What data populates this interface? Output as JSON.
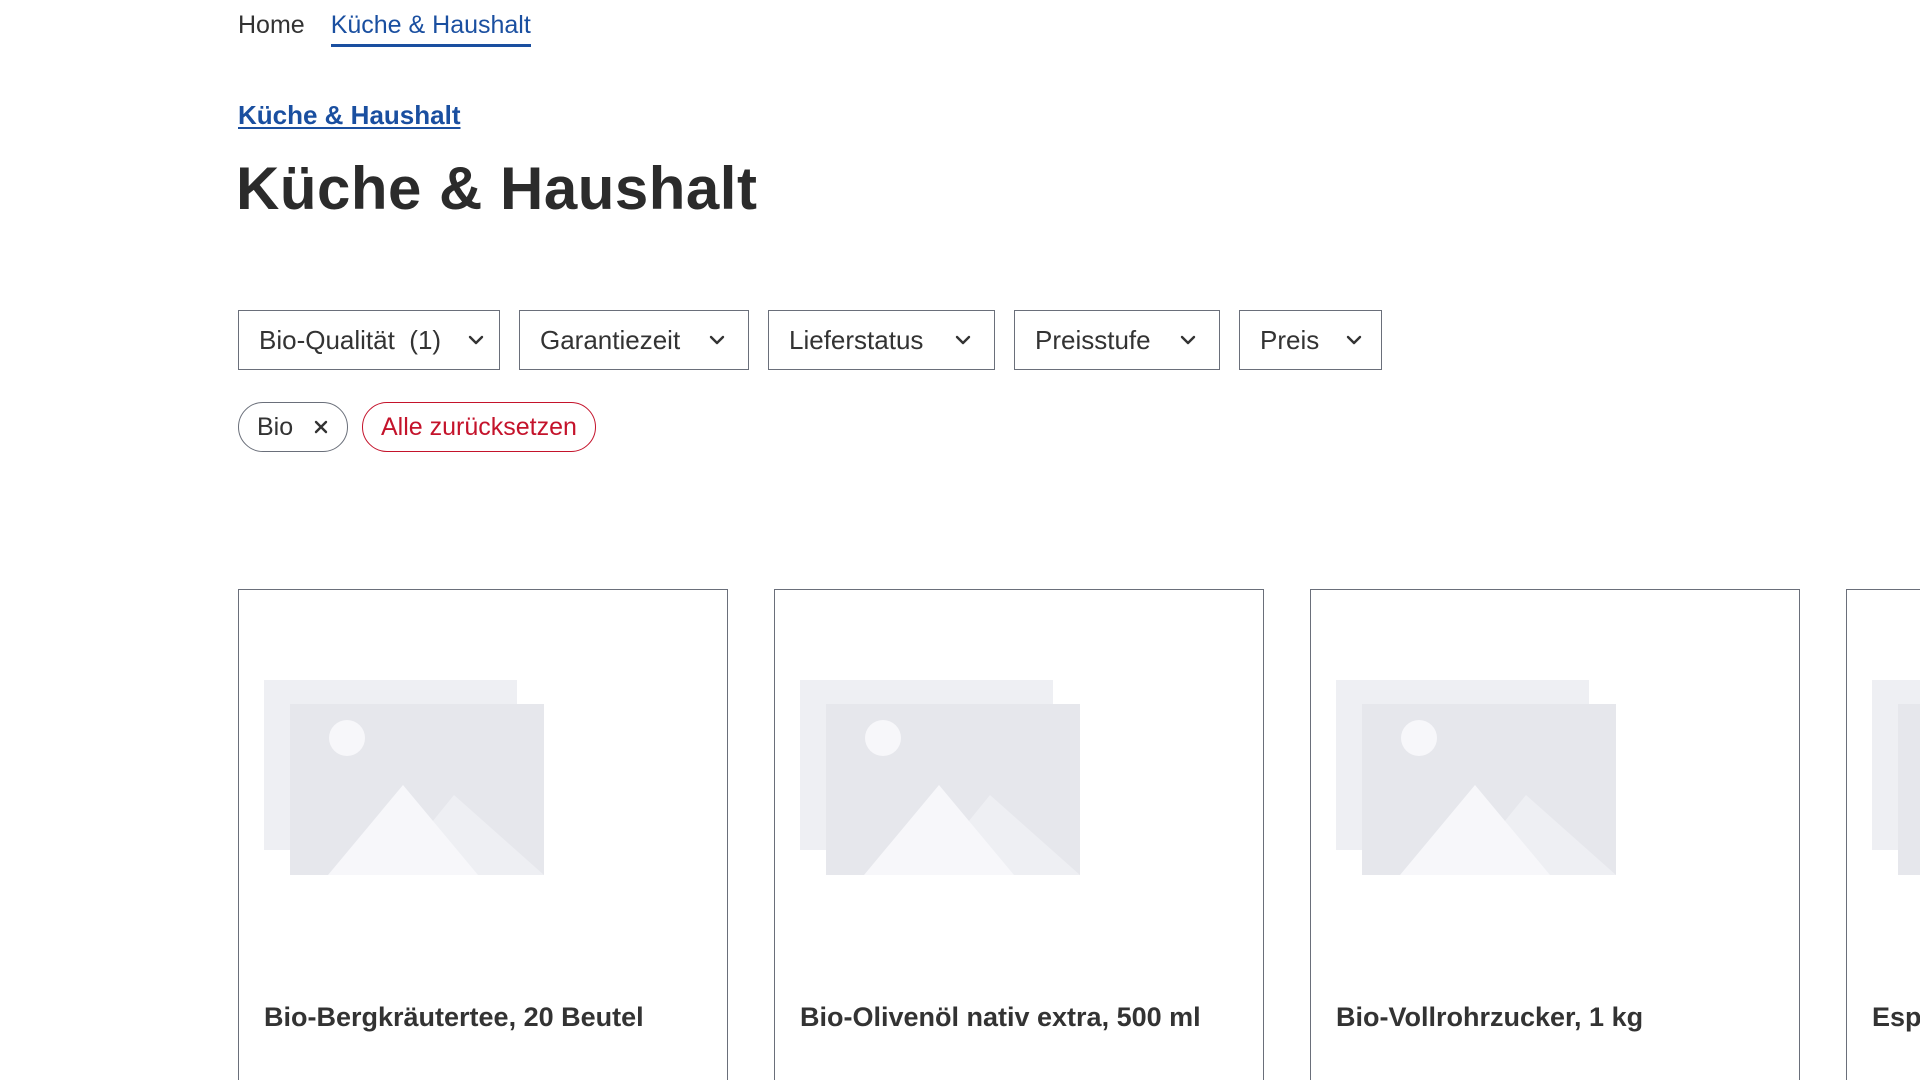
{
  "breadcrumb": {
    "home": "Home",
    "current": "Küche & Haushalt"
  },
  "category_link": "Küche & Haushalt",
  "page_title": "Küche & Haushalt",
  "filters": [
    {
      "label": "Bio-Qualität  (1)"
    },
    {
      "label": "Garantiezeit"
    },
    {
      "label": "Lieferstatus"
    },
    {
      "label": "Preisstufe"
    },
    {
      "label": "Preis"
    }
  ],
  "active_filters": {
    "bio_chip": "Bio",
    "remove_symbol": "×",
    "reset_all": "Alle zurücksetzen"
  },
  "products": [
    {
      "name": "Bio-Bergkräutertee, 20 Beutel"
    },
    {
      "name": "Bio-Olivenöl nativ extra, 500 ml"
    },
    {
      "name": "Bio-Vollrohrzucker, 1 kg"
    },
    {
      "name": "Esp"
    }
  ],
  "colors": {
    "link_blue": "#1a4fa0",
    "reset_red": "#c4132b",
    "border_gray": "#6a6f7a",
    "placeholder_gray": "#e6e7ec"
  },
  "icons": {
    "filter_chevron": "chevron-down-icon",
    "chip_remove": "close-icon",
    "product_placeholder": "image-placeholder-icon"
  }
}
